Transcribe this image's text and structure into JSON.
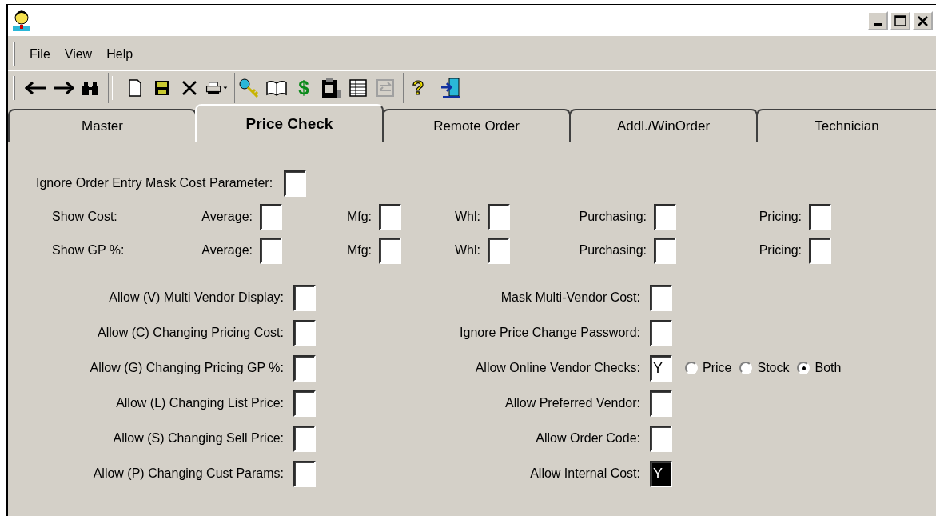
{
  "menu": [
    {
      "label": "File"
    },
    {
      "label": "View"
    },
    {
      "label": "Help"
    }
  ],
  "toolbar": {
    "dollar_glyph": "$",
    "help_glyph": "?"
  },
  "tabs": [
    {
      "label": "Master",
      "selected": false
    },
    {
      "label": "Price Check",
      "selected": true
    },
    {
      "label": "Remote Order",
      "selected": false
    },
    {
      "label": "Addl./WinOrder",
      "selected": false
    },
    {
      "label": "Technician",
      "selected": false
    }
  ],
  "top_field": {
    "label": "Ignore Order Entry Mask Cost Parameter:"
  },
  "cost_rows": [
    {
      "label": "Show Cost:",
      "fields": [
        {
          "label": "Average:"
        },
        {
          "label": "Mfg:"
        },
        {
          "label": "Whl:"
        },
        {
          "label": "Purchasing:"
        },
        {
          "label": "Pricing:"
        }
      ]
    },
    {
      "label": "Show GP %:",
      "fields": [
        {
          "label": "Average:"
        },
        {
          "label": "Mfg:"
        },
        {
          "label": "Whl:"
        },
        {
          "label": "Purchasing:"
        },
        {
          "label": "Pricing:"
        }
      ]
    }
  ],
  "left_fields": [
    {
      "label": "Allow (V) Multi Vendor Display:"
    },
    {
      "label": "Allow (C) Changing Pricing Cost:"
    },
    {
      "label": "Allow (G) Changing Pricing GP %:"
    },
    {
      "label": "Allow (L) Changing List Price:"
    },
    {
      "label": "Allow (S) Changing Sell Price:"
    },
    {
      "label": "Allow (P) Changing Cust Params:"
    }
  ],
  "right_fields": [
    {
      "label": "Mask Multi-Vendor Cost:"
    },
    {
      "label": "Ignore Price Change Password:"
    },
    {
      "label": "Allow Online Vendor Checks:",
      "value": "Y",
      "options": [
        {
          "label": "Price",
          "selected": false
        },
        {
          "label": "Stock",
          "selected": false
        },
        {
          "label": "Both",
          "selected": true
        }
      ]
    },
    {
      "label": "Allow Preferred Vendor:"
    },
    {
      "label": "Allow Order Code:"
    },
    {
      "label": "Allow Internal Cost:",
      "value": "Y",
      "highlighted": true
    }
  ]
}
